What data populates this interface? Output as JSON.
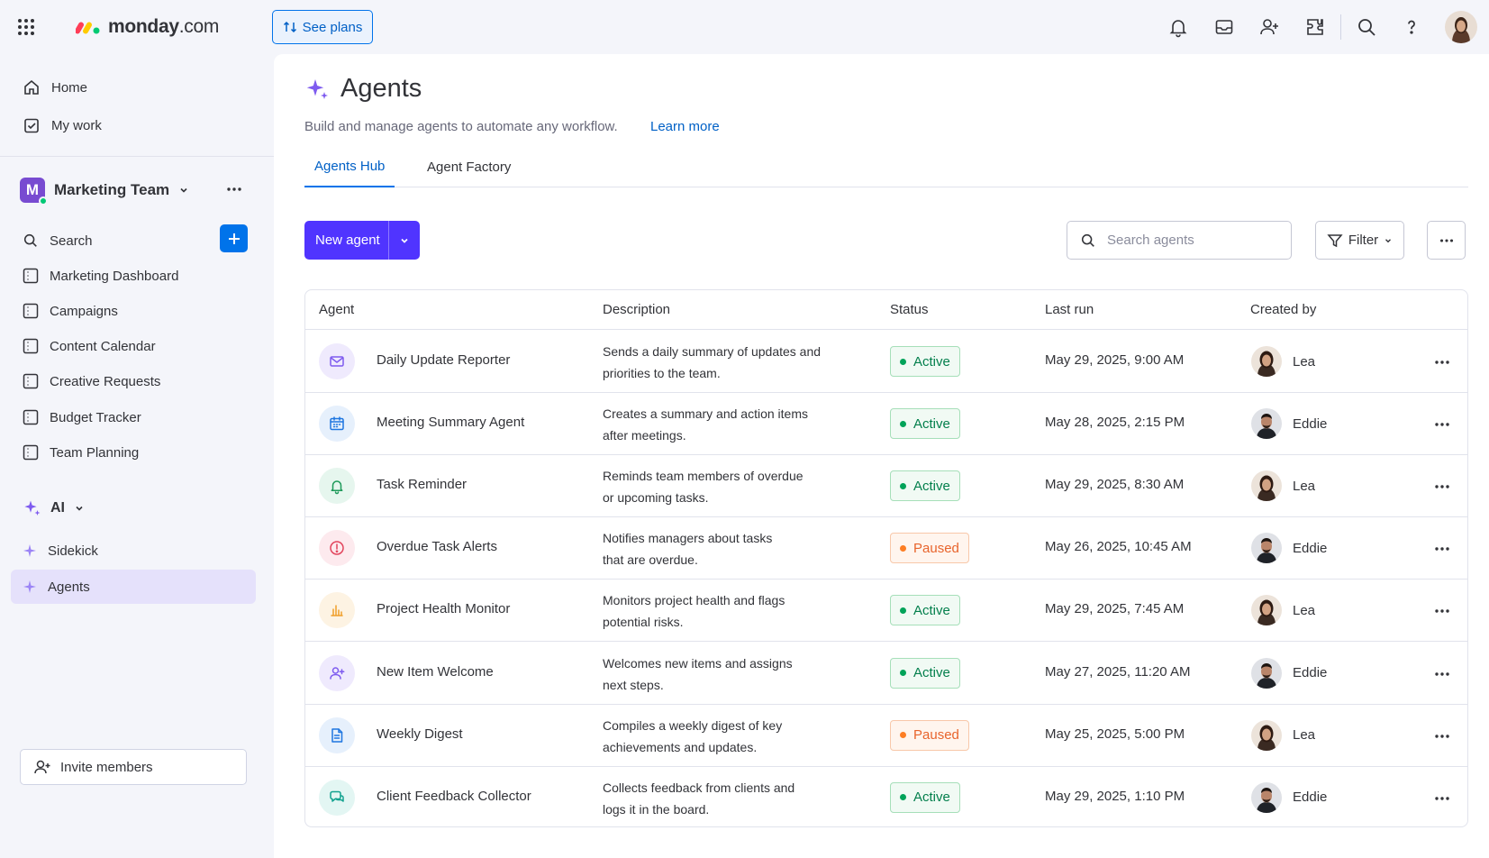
{
  "brand": {
    "name": "monday",
    "suffix": ".com",
    "colors": [
      "#ff3d57",
      "#ffcb00",
      "#00ca72"
    ]
  },
  "topbar": {
    "see_plans": "See plans",
    "icons": [
      "bell-icon",
      "inbox-icon",
      "invite-user-icon",
      "apps-marketplace-icon",
      "search-icon",
      "help-icon"
    ]
  },
  "sidebar": {
    "home": "Home",
    "my_work": "My work",
    "workspace": {
      "initial": "M",
      "name": "Marketing Team",
      "color": "#784bd1"
    },
    "search_label": "Search",
    "boards": [
      "Marketing Dashboard",
      "Campaigns",
      "Content Calendar",
      "Creative Requests",
      "Budget Tracker",
      "Team Planning"
    ],
    "ai_section": "AI",
    "ai_items": [
      "Sidekick",
      "Agents"
    ],
    "active_item": "Agents",
    "invite": "Invite members"
  },
  "page": {
    "title": "Agents",
    "subtitle": "Build and manage agents to automate any workflow.",
    "learn_more": "Learn more",
    "tabs": [
      "Agents Hub",
      "Agent Factory"
    ],
    "active_tab": "Agents Hub"
  },
  "toolbar": {
    "new_agent": "New agent",
    "search_placeholder": "Search agents",
    "filter": "Filter"
  },
  "table": {
    "columns": [
      "Agent",
      "Description",
      "Status",
      "Last run",
      "Created by"
    ],
    "rows": [
      {
        "name": "Daily Update Reporter",
        "desc1": "Sends a daily summary of updates and",
        "desc2": "priorities to the team.",
        "status": "Active",
        "last_run": "May 29, 2025, 9:00 AM",
        "creator": "Lea",
        "icon": "mail-icon",
        "icon_color": "#7e5bef",
        "icon_bg": "#efeafd"
      },
      {
        "name": "Meeting Summary Agent",
        "desc1": "Creates a summary and action items",
        "desc2": "after meetings.",
        "status": "Active",
        "last_run": "May 28, 2025, 2:15 PM",
        "creator": "Eddie",
        "icon": "calendar-icon",
        "icon_color": "#1f76e0",
        "icon_bg": "#e6f0fc"
      },
      {
        "name": "Task Reminder",
        "desc1": "Reminds team members of overdue",
        "desc2": "or upcoming tasks.",
        "status": "Active",
        "last_run": "May 29, 2025, 8:30 AM",
        "creator": "Lea",
        "icon": "bell-icon",
        "icon_color": "#1e9a5a",
        "icon_bg": "#e6f6ee"
      },
      {
        "name": "Overdue Task Alerts",
        "desc1": "Notifies managers about tasks",
        "desc2": "that are overdue.",
        "status": "Paused",
        "last_run": "May 26, 2025, 10:45 AM",
        "creator": "Eddie",
        "icon": "alert-icon",
        "icon_color": "#e2445c",
        "icon_bg": "#fdeaee"
      },
      {
        "name": "Project Health Monitor",
        "desc1": "Monitors project health and flags",
        "desc2": "potential risks.",
        "status": "Active",
        "last_run": "May 29, 2025, 7:45 AM",
        "creator": "Lea",
        "icon": "bar-chart-icon",
        "icon_color": "#f0a02a",
        "icon_bg": "#fdf3e3"
      },
      {
        "name": "New Item Welcome",
        "desc1": "Welcomes new items and assigns",
        "desc2": "next steps.",
        "status": "Active",
        "last_run": "May 27, 2025, 11:20 AM",
        "creator": "Eddie",
        "icon": "user-plus-icon",
        "icon_color": "#7e5bef",
        "icon_bg": "#efeafd"
      },
      {
        "name": "Weekly Digest",
        "desc1": "Compiles a weekly digest of key",
        "desc2": "achievements and updates.",
        "status": "Paused",
        "last_run": "May 25, 2025, 5:00 PM",
        "creator": "Lea",
        "icon": "document-icon",
        "icon_color": "#1f76e0",
        "icon_bg": "#e6f0fc"
      },
      {
        "name": "Client Feedback Collector",
        "desc1": "Collects feedback from clients and",
        "desc2": "logs it in the board.",
        "status": "Active",
        "last_run": "May 29, 2025, 1:10 PM",
        "creator": "Eddie",
        "icon": "chat-icon",
        "icon_color": "#12a28f",
        "icon_bg": "#e3f6f3"
      }
    ]
  }
}
